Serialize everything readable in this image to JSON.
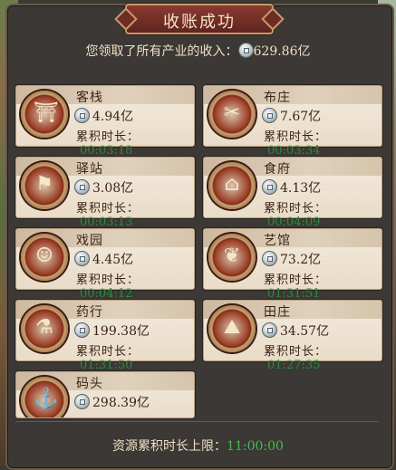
{
  "title": "收账成功",
  "summary": {
    "text": "您领取了所有产业的收入：",
    "amount": "629.86亿"
  },
  "time_label": "累积时长：",
  "icon_name": "silver-coin-icon",
  "industries": [
    {
      "name": "客栈",
      "amount": "4.94亿",
      "time": "00:03:18",
      "icon": "inn-icon"
    },
    {
      "name": "布庄",
      "amount": "7.67亿",
      "time": "00:03:34",
      "icon": "cloth-shop-icon"
    },
    {
      "name": "驿站",
      "amount": "3.08亿",
      "time": "00:03:13",
      "icon": "post-station-icon"
    },
    {
      "name": "食府",
      "amount": "4.13亿",
      "time": "00:04:09",
      "icon": "restaurant-icon"
    },
    {
      "name": "戏园",
      "amount": "4.45亿",
      "time": "00:04:12",
      "icon": "theater-icon"
    },
    {
      "name": "艺馆",
      "amount": "73.2亿",
      "time": "01:31:51",
      "icon": "art-hall-icon"
    },
    {
      "name": "药行",
      "amount": "199.38亿",
      "time": "01:31:50",
      "icon": "pharmacy-icon"
    },
    {
      "name": "田庄",
      "amount": "34.57亿",
      "time": "01:27:35",
      "icon": "farm-icon"
    },
    {
      "name": "码头",
      "amount": "298.39亿",
      "time": "",
      "icon": "dock-icon"
    }
  ],
  "footer": {
    "label": "资源累积时长上限：",
    "time": "11:00:00"
  },
  "colors": {
    "time_green": "#2f8a3a",
    "footer_green": "#3fbf4f",
    "title_red": "#8a3a30"
  }
}
